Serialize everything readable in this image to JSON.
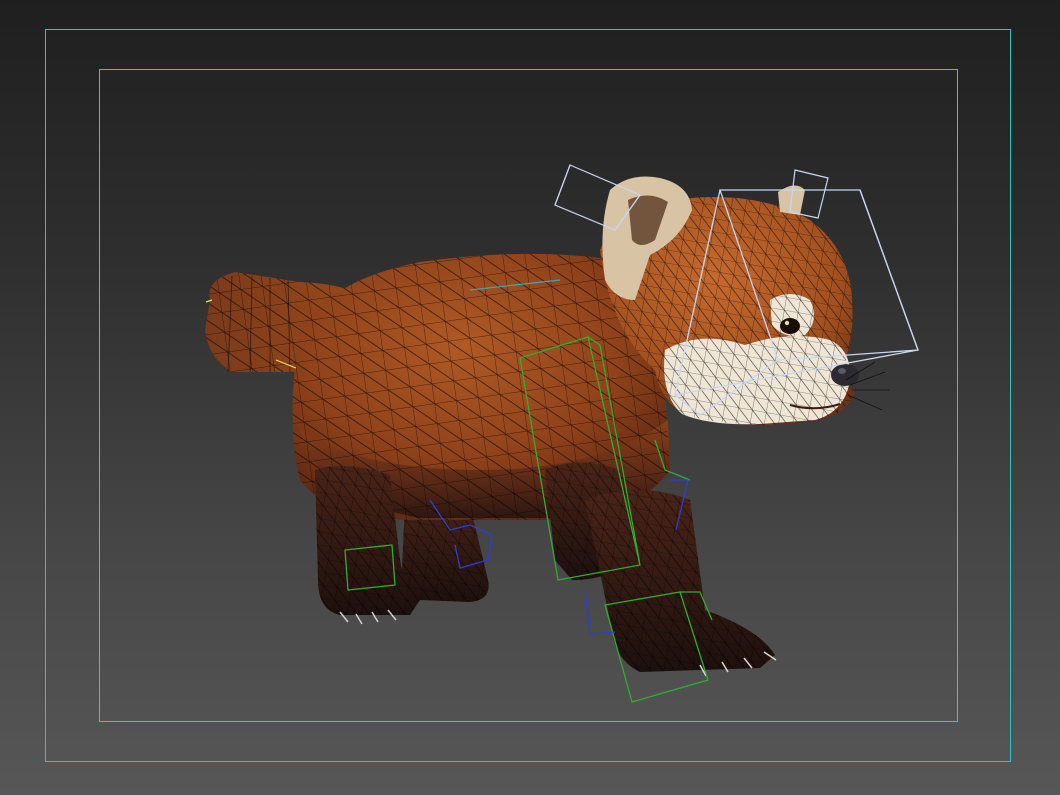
{
  "viewport": {
    "background_top": "#1f1f1f",
    "background_bottom": "#575757",
    "safe_frame_outer_color": "#2fc4c4",
    "safe_frame_inner_color": "#d39a1c"
  },
  "model": {
    "subject": "red-panda-3d-model",
    "display_mode": "textured-with-wireframe-overlay",
    "fur_color": "#9a4a1c",
    "face_color": "#efe3cf",
    "leg_color": "#2a1714",
    "wireframe_color": "#000000"
  },
  "rig": {
    "head_bone_color": "#c9d6f0",
    "front_leg_bone_color": "#2fae2f",
    "back_leg_bone_color": "#2a3fd6",
    "tail_bone_color": "#e6e26a"
  }
}
